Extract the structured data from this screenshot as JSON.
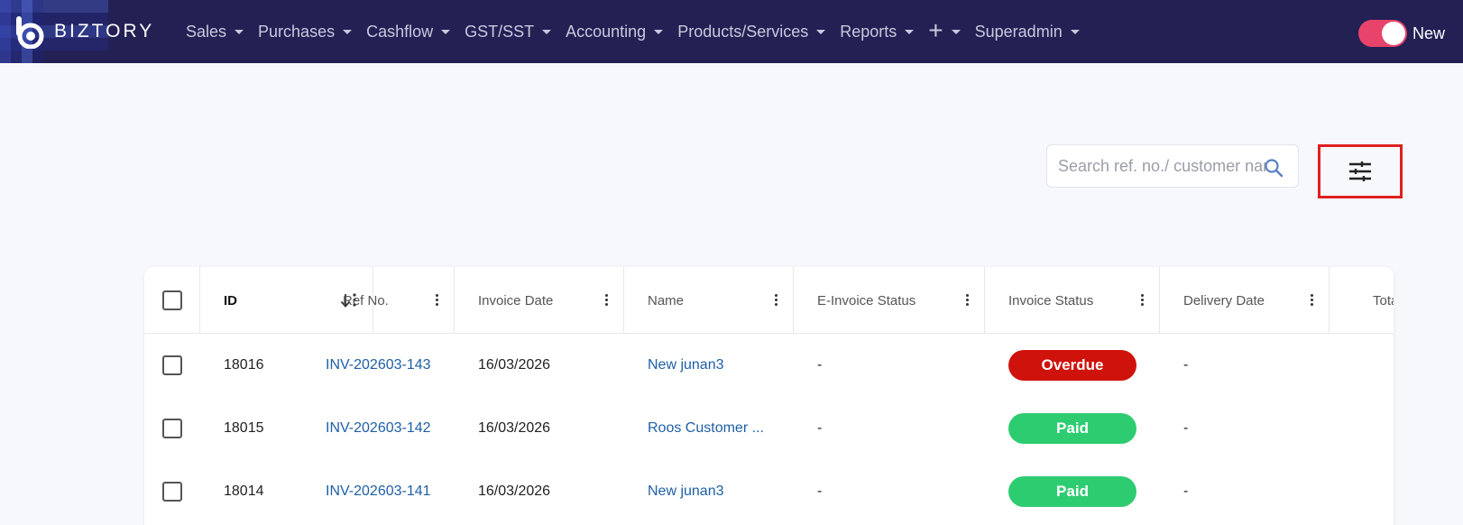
{
  "brand": {
    "name": "BIZTORY"
  },
  "nav": {
    "items": [
      {
        "label": "Sales"
      },
      {
        "label": "Purchases"
      },
      {
        "label": "Cashflow"
      },
      {
        "label": "GST/SST"
      },
      {
        "label": "Accounting"
      },
      {
        "label": "Products/Services"
      },
      {
        "label": "Reports"
      }
    ],
    "plus_icon": "plus-icon",
    "user": {
      "label": "Superadmin"
    },
    "toggle": {
      "label": "New",
      "on": true,
      "color": "#e8436a"
    }
  },
  "search": {
    "placeholder": "Search ref. no./ customer name",
    "value": ""
  },
  "filter": {
    "icon": "sliders-icon",
    "highlight_color": "#e02020"
  },
  "table": {
    "columns": [
      {
        "label": "ID",
        "sort_icon": "sort-desc-icon"
      },
      {
        "label": "Ref No."
      },
      {
        "label": "Invoice Date"
      },
      {
        "label": "Name"
      },
      {
        "label": "E-Invoice Status"
      },
      {
        "label": "Invoice Status"
      },
      {
        "label": "Delivery Date"
      },
      {
        "label": "Tota"
      }
    ],
    "rows": [
      {
        "id": "18016",
        "ref": "INV-202603-143",
        "date": "16/03/2026",
        "name": "New junan3",
        "einvoice": "-",
        "status": "Overdue",
        "status_color": "#d0120c",
        "delivery": "-"
      },
      {
        "id": "18015",
        "ref": "INV-202603-142",
        "date": "16/03/2026",
        "name": "Roos Customer ...",
        "einvoice": "-",
        "status": "Paid",
        "status_color": "#2ecc71",
        "delivery": "-"
      },
      {
        "id": "18014",
        "ref": "INV-202603-141",
        "date": "16/03/2026",
        "name": "New junan3",
        "einvoice": "-",
        "status": "Paid",
        "status_color": "#2ecc71",
        "delivery": "-"
      }
    ]
  },
  "colors": {
    "nav_bg": "#232054",
    "link": "#1f5fa6",
    "page_bg": "#f6f8fb"
  }
}
